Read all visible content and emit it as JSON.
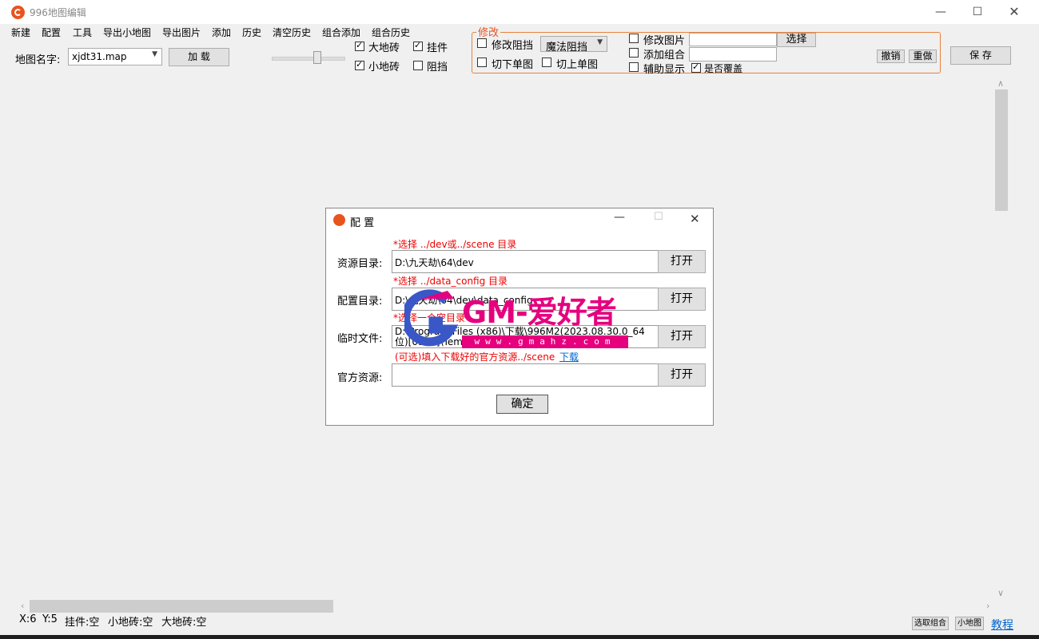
{
  "window": {
    "title": "996地图编辑"
  },
  "menu": [
    "新建",
    "配置",
    "工具",
    "导出小地图",
    "导出图片",
    "添加",
    "历史",
    "清空历史",
    "组合添加",
    "组合历史"
  ],
  "toolbar": {
    "map_name_label": "地图名字:",
    "map_name_value": "xjdt31.map",
    "load_button": "加 载",
    "checkboxes": {
      "big_tile": {
        "label": "大地砖",
        "checked": true
      },
      "hanging": {
        "label": "挂件",
        "checked": true
      },
      "small_tile": {
        "label": "小地砖",
        "checked": true
      },
      "block": {
        "label": "阻挡",
        "checked": false
      }
    },
    "modify_group": {
      "legend": "修改",
      "modify_block": "修改阻挡",
      "block_type": "魔法阻挡",
      "cut_down": "切下单图",
      "cut_up": "切上单图",
      "modify_image": "修改图片",
      "add_combo": "添加组合",
      "aux_display": "辅助显示",
      "overwrite": "是否覆盖",
      "select_button": "选择",
      "undo_button": "撤销",
      "redo_button": "重做"
    },
    "save_button": "保 存"
  },
  "dialog": {
    "title": "配 置",
    "rows": [
      {
        "hint": "*选择 ../dev或../scene 目录",
        "label": "资源目录:",
        "value": "D:\\九天劫\\64\\dev",
        "button": "打开"
      },
      {
        "hint": "*选择 ../data_config 目录",
        "label": "配置目录:",
        "value": "D:\\九天劫\\64\\dev\\data_config",
        "button": "打开"
      },
      {
        "hint": "*选择一个空目录",
        "label": "临时文件:",
        "value": "D:\\Program Files (x86)\\下载\\996M2(2023.08.30.0_64位)[0927]\\Temp",
        "button": "打开"
      },
      {
        "hint": "(可选)填入下载好的官方资源../scene",
        "link": "下载",
        "label": "官方资源:",
        "value": "",
        "button": "打开"
      }
    ],
    "ok_button": "确定"
  },
  "watermark": {
    "text": "GM-爱好者",
    "url": "www.gmahz.com"
  },
  "status": {
    "x": "X:6",
    "y": "Y:5",
    "hanging": "挂件:空",
    "small_tile": "小地砖:空",
    "big_tile": "大地砖:空",
    "select_combo": "选取组合",
    "minimap": "小地图",
    "tutorial": "教程"
  },
  "colors": {
    "accent": "#e8541d",
    "hint": "#e00000",
    "watermark": "#e5007f"
  }
}
